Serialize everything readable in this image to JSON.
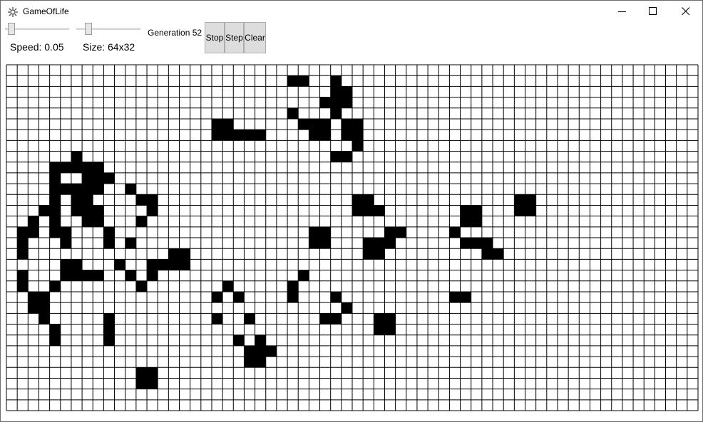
{
  "window": {
    "title": "GameOfLife",
    "app_icon": "gear-icon",
    "minimize_icon": "minimize-icon",
    "maximize_icon": "maximize-icon",
    "close_icon": "close-icon"
  },
  "controls": {
    "speed": {
      "label": "Speed: 0.05",
      "slider_value_fraction": 0.05
    },
    "size": {
      "label": "Size: 64x32",
      "slider_value_fraction": 0.15
    },
    "generation_label": "Generation 52",
    "stop_label": "Stop",
    "step_label": "Step",
    "clear_label": "Clear"
  },
  "grid": {
    "columns": 64,
    "rows": 32,
    "live_color": "#000000",
    "dead_color": "#ffffff",
    "line_color": "#000000",
    "live_cells": [
      [
        26,
        1
      ],
      [
        27,
        1
      ],
      [
        30,
        1
      ],
      [
        30,
        2
      ],
      [
        31,
        2
      ],
      [
        29,
        3
      ],
      [
        30,
        3
      ],
      [
        31,
        3
      ],
      [
        26,
        4
      ],
      [
        30,
        4
      ],
      [
        19,
        5
      ],
      [
        20,
        5
      ],
      [
        27,
        5
      ],
      [
        28,
        5
      ],
      [
        29,
        5
      ],
      [
        31,
        5
      ],
      [
        32,
        5
      ],
      [
        19,
        6
      ],
      [
        20,
        6
      ],
      [
        21,
        6
      ],
      [
        22,
        6
      ],
      [
        23,
        6
      ],
      [
        28,
        6
      ],
      [
        29,
        6
      ],
      [
        31,
        6
      ],
      [
        32,
        6
      ],
      [
        32,
        7
      ],
      [
        6,
        8
      ],
      [
        30,
        8
      ],
      [
        31,
        8
      ],
      [
        4,
        9
      ],
      [
        5,
        9
      ],
      [
        6,
        9
      ],
      [
        7,
        9
      ],
      [
        8,
        9
      ],
      [
        4,
        10
      ],
      [
        7,
        10
      ],
      [
        8,
        10
      ],
      [
        9,
        10
      ],
      [
        4,
        11
      ],
      [
        5,
        11
      ],
      [
        6,
        11
      ],
      [
        7,
        11
      ],
      [
        8,
        11
      ],
      [
        11,
        11
      ],
      [
        4,
        12
      ],
      [
        6,
        12
      ],
      [
        7,
        12
      ],
      [
        12,
        12
      ],
      [
        13,
        12
      ],
      [
        32,
        12
      ],
      [
        33,
        12
      ],
      [
        47,
        12
      ],
      [
        48,
        12
      ],
      [
        3,
        13
      ],
      [
        4,
        13
      ],
      [
        6,
        13
      ],
      [
        7,
        13
      ],
      [
        8,
        13
      ],
      [
        13,
        13
      ],
      [
        32,
        13
      ],
      [
        33,
        13
      ],
      [
        34,
        13
      ],
      [
        42,
        13
      ],
      [
        43,
        13
      ],
      [
        47,
        13
      ],
      [
        48,
        13
      ],
      [
        2,
        14
      ],
      [
        4,
        14
      ],
      [
        7,
        14
      ],
      [
        8,
        14
      ],
      [
        12,
        14
      ],
      [
        42,
        14
      ],
      [
        43,
        14
      ],
      [
        1,
        15
      ],
      [
        2,
        15
      ],
      [
        4,
        15
      ],
      [
        5,
        15
      ],
      [
        9,
        15
      ],
      [
        28,
        15
      ],
      [
        29,
        15
      ],
      [
        35,
        15
      ],
      [
        36,
        15
      ],
      [
        41,
        15
      ],
      [
        1,
        16
      ],
      [
        5,
        16
      ],
      [
        9,
        16
      ],
      [
        11,
        16
      ],
      [
        28,
        16
      ],
      [
        29,
        16
      ],
      [
        33,
        16
      ],
      [
        34,
        16
      ],
      [
        35,
        16
      ],
      [
        42,
        16
      ],
      [
        43,
        16
      ],
      [
        44,
        16
      ],
      [
        1,
        17
      ],
      [
        15,
        17
      ],
      [
        16,
        17
      ],
      [
        33,
        17
      ],
      [
        34,
        17
      ],
      [
        44,
        17
      ],
      [
        45,
        17
      ],
      [
        5,
        18
      ],
      [
        6,
        18
      ],
      [
        10,
        18
      ],
      [
        13,
        18
      ],
      [
        14,
        18
      ],
      [
        15,
        18
      ],
      [
        16,
        18
      ],
      [
        1,
        19
      ],
      [
        5,
        19
      ],
      [
        6,
        19
      ],
      [
        7,
        19
      ],
      [
        8,
        19
      ],
      [
        11,
        19
      ],
      [
        13,
        19
      ],
      [
        27,
        19
      ],
      [
        1,
        20
      ],
      [
        4,
        20
      ],
      [
        12,
        20
      ],
      [
        20,
        20
      ],
      [
        26,
        20
      ],
      [
        2,
        21
      ],
      [
        3,
        21
      ],
      [
        19,
        21
      ],
      [
        21,
        21
      ],
      [
        26,
        21
      ],
      [
        30,
        21
      ],
      [
        41,
        21
      ],
      [
        42,
        21
      ],
      [
        2,
        22
      ],
      [
        3,
        22
      ],
      [
        31,
        22
      ],
      [
        3,
        23
      ],
      [
        9,
        23
      ],
      [
        19,
        23
      ],
      [
        22,
        23
      ],
      [
        29,
        23
      ],
      [
        30,
        23
      ],
      [
        34,
        23
      ],
      [
        35,
        23
      ],
      [
        4,
        24
      ],
      [
        9,
        24
      ],
      [
        34,
        24
      ],
      [
        35,
        24
      ],
      [
        4,
        25
      ],
      [
        9,
        25
      ],
      [
        21,
        25
      ],
      [
        23,
        25
      ],
      [
        22,
        26
      ],
      [
        23,
        26
      ],
      [
        24,
        26
      ],
      [
        22,
        27
      ],
      [
        23,
        27
      ],
      [
        12,
        28
      ],
      [
        13,
        28
      ],
      [
        12,
        29
      ],
      [
        13,
        29
      ]
    ]
  }
}
